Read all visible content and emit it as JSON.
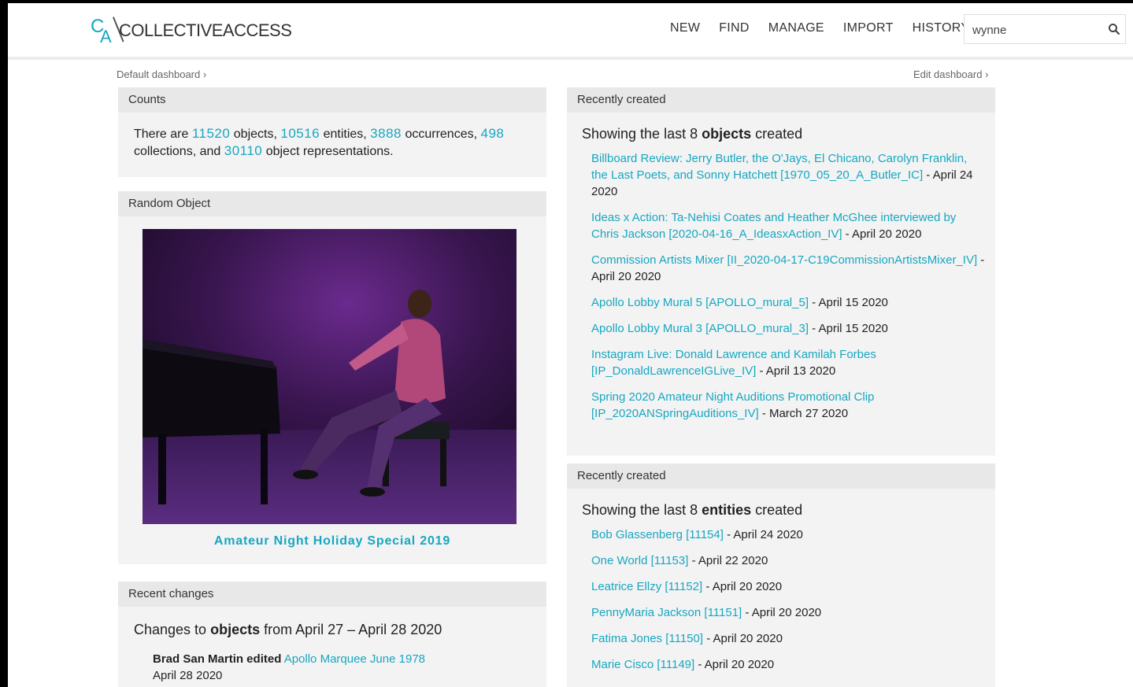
{
  "header": {
    "logo_letters": "CA",
    "logo_text": "COLLECTIVEACCESS",
    "nav": [
      "NEW",
      "FIND",
      "MANAGE",
      "IMPORT",
      "HISTORY"
    ],
    "search_value": "wynne"
  },
  "dashboard": {
    "default_link": "Default dashboard ›",
    "edit_link": "Edit dashboard ›"
  },
  "counts": {
    "title": "Counts",
    "t1": "There are ",
    "objects": "11520",
    "t2": " objects, ",
    "entities": "10516",
    "t3": " entities, ",
    "occurrences": "3888",
    "t4": " occurrences, ",
    "collections": "498",
    "t5": " collections, and ",
    "representations": "30110",
    "t6": " object representations."
  },
  "random": {
    "title": "Random Object",
    "caption": "Amateur Night Holiday Special 2019"
  },
  "changes": {
    "title": "Recent changes",
    "sub_pre": "Changes to ",
    "sub_bold": "objects",
    "sub_post": " from April 27 – April 28 2020",
    "entry_user": "Brad San Martin edited",
    "entry_link": "Apollo Marquee June 1978",
    "entry_date": "April 28 2020"
  },
  "created_objects": {
    "title": "Recently created",
    "sub_pre": "Showing the last 8 ",
    "sub_bold": "objects",
    "sub_post": " created",
    "items": [
      {
        "link": "Billboard Review: Jerry Butler, the O'Jays, El Chicano, Carolyn Franklin, the Last Poets, and Sonny Hatchett [1970_05_20_A_Butler_IC]",
        "date": " - April 24 2020"
      },
      {
        "link": "Ideas x Action: Ta-Nehisi Coates and Heather McGhee interviewed by Chris Jackson [2020-04-16_A_IdeasxAction_IV]",
        "date": " - April 20 2020"
      },
      {
        "link": "Commission Artists Mixer [II_2020-04-17-C19CommissionArtistsMixer_IV]",
        "date": " - April 20 2020"
      },
      {
        "link": "Apollo Lobby Mural 5 [APOLLO_mural_5]",
        "date": " - April 15 2020"
      },
      {
        "link": "Apollo Lobby Mural 3 [APOLLO_mural_3]",
        "date": " - April 15 2020"
      },
      {
        "link": "Instagram Live: Donald Lawrence and Kamilah Forbes [IP_DonaldLawrenceIGLive_IV]",
        "date": " - April 13 2020"
      },
      {
        "link": "Spring 2020 Amateur Night Auditions Promotional Clip [IP_2020ANSpringAuditions_IV]",
        "date": " - March 27 2020"
      }
    ]
  },
  "created_entities": {
    "title": "Recently created",
    "sub_pre": "Showing the last 8 ",
    "sub_bold": "entities",
    "sub_post": " created",
    "items": [
      {
        "link": "Bob Glassenberg [11154]",
        "date": " - April 24 2020"
      },
      {
        "link": "One World [11153]",
        "date": " - April 22 2020"
      },
      {
        "link": "Leatrice Ellzy [11152]",
        "date": " - April 20 2020"
      },
      {
        "link": "PennyMaria Jackson [11151]",
        "date": " - April 20 2020"
      },
      {
        "link": "Fatima Jones [11150]",
        "date": " - April 20 2020"
      },
      {
        "link": "Marie Cisco [11149]",
        "date": " - April 20 2020"
      }
    ]
  },
  "colors": {
    "accent": "#17a7c1",
    "panel": "#f3f3f3",
    "panel_header": "#e8e8e8"
  },
  "icons": {
    "search": "search-icon"
  }
}
